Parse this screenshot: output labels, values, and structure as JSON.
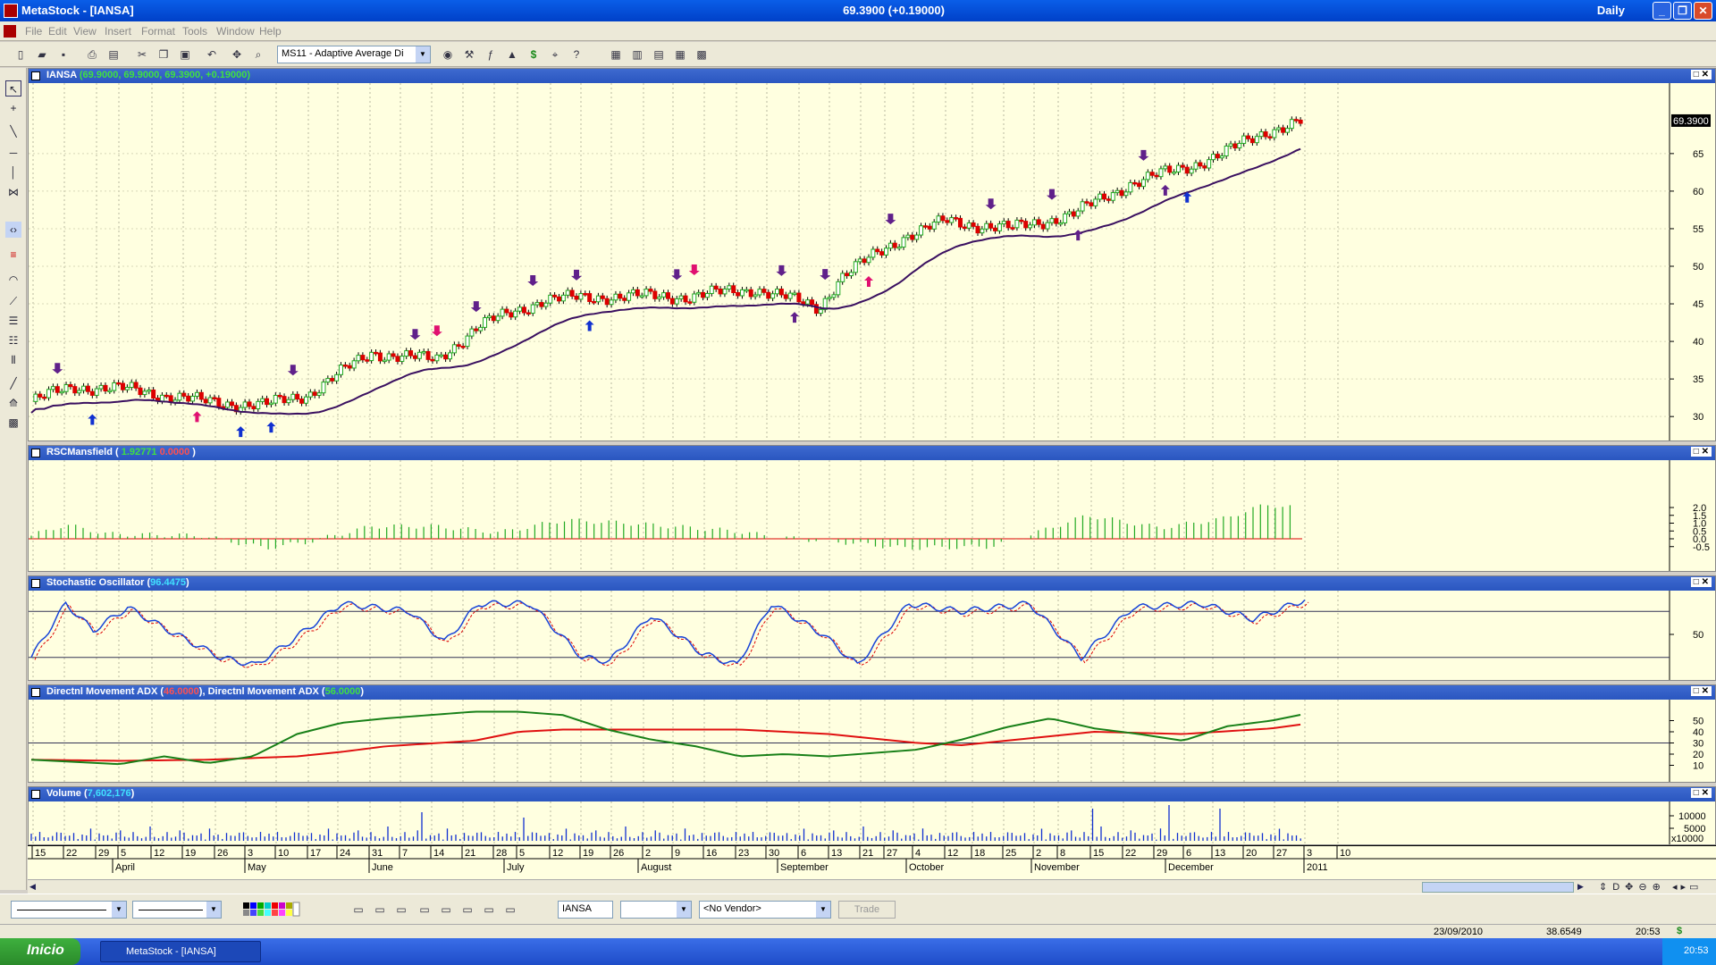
{
  "window": {
    "title": "MetaStock - [IANSA]",
    "center_text": "69.3900 (+0.19000)",
    "period": "Daily"
  },
  "menu": [
    "File",
    "Edit",
    "View",
    "Insert",
    "Format",
    "Tools",
    "Window",
    "Help"
  ],
  "toolbar": {
    "expert_combo": "MS11 - Adaptive Average Di"
  },
  "panes": {
    "price": {
      "title": "IANSA",
      "values": "(69.9000, 69.9000, 69.3900, +0.19000)",
      "last_label": "69.3900",
      "ticks": [
        "65",
        "60",
        "55",
        "50",
        "45",
        "40",
        "35",
        "30"
      ]
    },
    "rsc": {
      "title": "RSCMansfield",
      "value1": "1.92771",
      "value2": "0.0000",
      "ticks": [
        "2.0",
        "1.5",
        "1.0",
        "0.5",
        "0.0",
        "-0.5"
      ]
    },
    "stoch": {
      "title": "Stochastic Oscillator",
      "value": "96.4475",
      "ticks": [
        "50"
      ]
    },
    "adx": {
      "title1": "Directnl Movement ADX",
      "value1": "46.0000",
      "title2": "Directnl Movement ADX",
      "value2": "56.0000",
      "ticks": [
        "50",
        "40",
        "30",
        "20",
        "10"
      ]
    },
    "volume": {
      "title": "Volume",
      "value": "7,602,176",
      "ticks": [
        "10000",
        "5000",
        "x10000"
      ]
    }
  },
  "xaxis": {
    "days": [
      [
        "15",
        5
      ],
      [
        "22",
        40
      ],
      [
        "29",
        76
      ],
      [
        "5",
        101
      ],
      [
        "12",
        138
      ],
      [
        "19",
        173
      ],
      [
        "26",
        209
      ],
      [
        "3",
        243
      ],
      [
        "10",
        277
      ],
      [
        "17",
        313
      ],
      [
        "24",
        346
      ],
      [
        "31",
        382
      ],
      [
        "7",
        416
      ],
      [
        "14",
        451
      ],
      [
        "21",
        486
      ],
      [
        "28",
        521
      ],
      [
        "5",
        547
      ],
      [
        "12",
        584
      ],
      [
        "19",
        618
      ],
      [
        "26",
        652
      ],
      [
        "2",
        688
      ],
      [
        "9",
        721
      ],
      [
        "16",
        756
      ],
      [
        "23",
        792
      ],
      [
        "30",
        826
      ],
      [
        "6",
        862
      ],
      [
        "13",
        896
      ],
      [
        "21",
        931
      ],
      [
        "27",
        958
      ],
      [
        "4",
        990
      ],
      [
        "12",
        1026
      ],
      [
        "18",
        1056
      ],
      [
        "25",
        1091
      ],
      [
        "2",
        1125
      ],
      [
        "8",
        1152
      ],
      [
        "15",
        1189
      ],
      [
        "22",
        1225
      ],
      [
        "29",
        1260
      ],
      [
        "6",
        1293
      ],
      [
        "13",
        1325
      ],
      [
        "20",
        1360
      ],
      [
        "27",
        1394
      ],
      [
        "3",
        1428
      ],
      [
        "10",
        1465
      ]
    ],
    "months": [
      [
        "April",
        95
      ],
      [
        "May",
        243
      ],
      [
        "June",
        382
      ],
      [
        "July",
        533
      ],
      [
        "August",
        683
      ],
      [
        "September",
        839
      ],
      [
        "October",
        983
      ],
      [
        "November",
        1123
      ],
      [
        "December",
        1273
      ],
      [
        "2011",
        1428
      ]
    ]
  },
  "bottom": {
    "symbol": "IANSA",
    "vendor": "<No Vendor>",
    "trade_label": "Trade"
  },
  "status": {
    "date": "23/09/2010",
    "value": "38.6549",
    "time": "20:53"
  },
  "taskbar": {
    "start": "Inicio",
    "task": "MetaStock - [IANSA]",
    "clock": "20:53"
  },
  "colors": {
    "up": "#22aa22",
    "down": "#dd0000",
    "ma": "#3a1060",
    "buy_arrow": "#1030d0",
    "sell_arrow": "#e01070",
    "big_arrow": "#60208a",
    "stoch": "#1844d8",
    "adx_green": "#188018",
    "adx_red": "#e01010"
  }
}
